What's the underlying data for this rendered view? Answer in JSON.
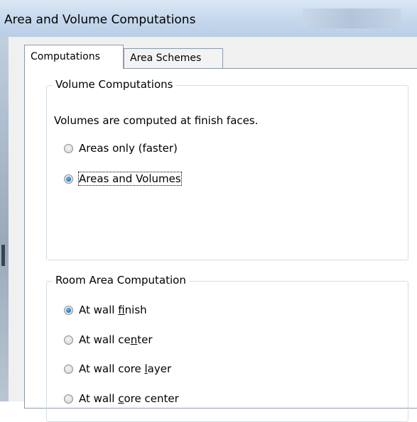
{
  "window": {
    "title": "Area and Volume Computations"
  },
  "tabs": [
    {
      "label": "Computations",
      "active": true
    },
    {
      "label": "Area Schemes",
      "active": false
    }
  ],
  "volume_group": {
    "legend": "Volume Computations",
    "description": "Volumes are computed at finish faces.",
    "options": [
      {
        "label": "Areas only (faster)",
        "checked": false
      },
      {
        "label": "Areas and Volumes",
        "checked": true,
        "focused": true
      }
    ]
  },
  "room_group": {
    "legend": "Room Area Computation",
    "options": [
      {
        "prefix": "At wall ",
        "mnemonic": "f",
        "suffix": "inish",
        "checked": true
      },
      {
        "prefix": "At wall ce",
        "mnemonic": "n",
        "suffix": "ter",
        "checked": false
      },
      {
        "prefix": "At wall core ",
        "mnemonic": "l",
        "suffix": "ayer",
        "checked": false
      },
      {
        "prefix": "At wall ",
        "mnemonic": "c",
        "suffix": "ore center",
        "checked": false
      }
    ]
  },
  "colors": {
    "titlebar": "#c5d7ec",
    "dialog_bg": "#f0f0f0",
    "radio_selected": "#1e7fc8",
    "group_border": "#d5dfe5"
  }
}
